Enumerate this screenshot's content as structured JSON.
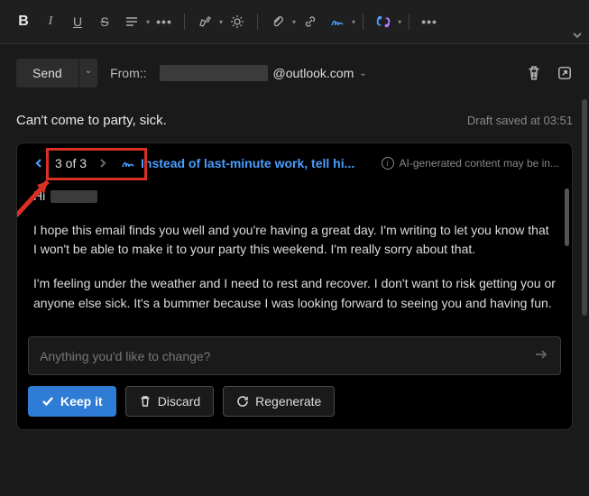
{
  "toolbar": {
    "icons": [
      "bold-icon",
      "italic-icon",
      "underline-icon",
      "strikethrough-icon",
      "line-height-icon",
      "more-formatting-icon",
      "highlight-icon",
      "brightness-icon",
      "attachment-icon",
      "link-icon",
      "signature-icon",
      "copilot-icon",
      "more-icon"
    ]
  },
  "send": {
    "label": "Send"
  },
  "from": {
    "label": "From::",
    "domain": "@outlook.com"
  },
  "subject": {
    "text": "Can't come to party, sick.",
    "draft_status": "Draft saved at 03:51"
  },
  "ai": {
    "pager": {
      "current": 3,
      "total": 3,
      "text": "3 of 3"
    },
    "suggestion_title": "Instead of last-minute work, tell hi...",
    "info_text": "AI-generated content may be in...",
    "body": {
      "greeting": "Hi",
      "p1": "I hope this email finds you well and you're having a great day. I'm writing to let you know that I won't be able to make it to your party this weekend. I'm really sorry about that.",
      "p2": "I'm feeling under the weather and I need to rest and recover. I don't want to risk getting you or anyone else sick. It's a bummer because I was looking forward to seeing you and having fun."
    },
    "input_placeholder": "Anything you'd like to change?",
    "actions": {
      "keep": "Keep it",
      "discard": "Discard",
      "regenerate": "Regenerate"
    }
  }
}
